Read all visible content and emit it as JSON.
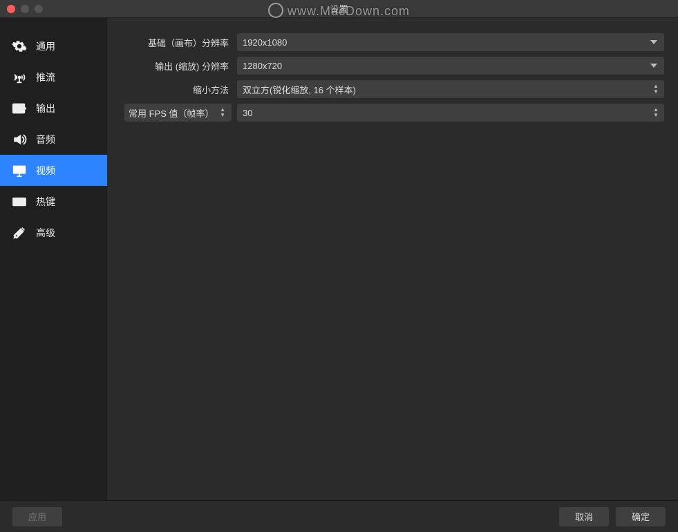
{
  "window": {
    "title": "设置"
  },
  "watermark": "www.MacDown.com",
  "sidebar": {
    "items": [
      {
        "label": "通用"
      },
      {
        "label": "推流"
      },
      {
        "label": "输出"
      },
      {
        "label": "音频"
      },
      {
        "label": "视频"
      },
      {
        "label": "热键"
      },
      {
        "label": "高级"
      }
    ],
    "active_index": 4
  },
  "form": {
    "base_resolution": {
      "label": "基础（画布）分辨率",
      "value": "1920x1080"
    },
    "output_resolution": {
      "label": "输出 (缩放) 分辨率",
      "value": "1280x720"
    },
    "downscale_filter": {
      "label": "缩小方法",
      "value": "双立方(锐化缩放, 16 个样本)"
    },
    "fps": {
      "label": "常用 FPS 值（帧率）",
      "value": "30"
    }
  },
  "footer": {
    "apply": "应用",
    "cancel": "取消",
    "ok": "确定"
  }
}
